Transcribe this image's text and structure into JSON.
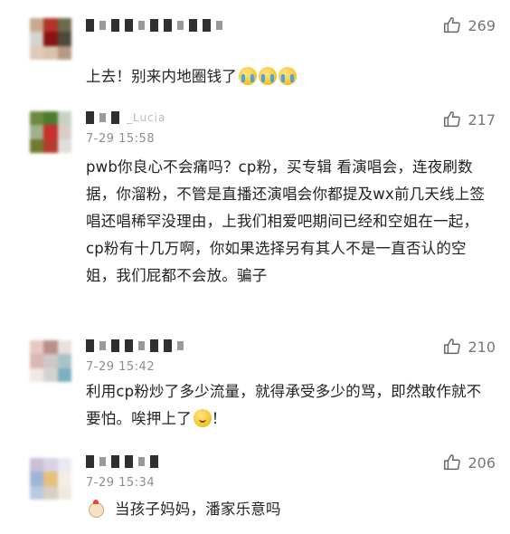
{
  "comments": [
    {
      "likes": "269",
      "time": "",
      "text": "上去！别来内地圈钱了",
      "emoji": [
        "cry",
        "cry",
        "cry"
      ],
      "avatar": [
        "#c9a98d",
        "#b3322c",
        "#6d6a4d",
        "#d5d3cf",
        "#8b1212",
        "#4d4a3a",
        "#e0c9b8",
        "#d9c3b0",
        "#b89984"
      ]
    },
    {
      "likes": "217",
      "time": "7-29 15:58",
      "username_fragment": "_Lucia",
      "text": "pwb你良心不会痛吗？cp粉，买专辑 看演唱会，连夜刷数据，你溜粉，不管是直播还演唱会你都提及wx前几天线上签唱还唱稀罕没理由，上我们相爱吧期间已经和空姐在一起，cp粉有十几万啊，你如果选择另有其人不是一直否认的空姐，我们屁都不会放。骗子",
      "avatar": [
        "#6c8a3d",
        "#4f7b2f",
        "#c7d3c2",
        "#9fb08b",
        "#c92f2f",
        "#d6cfc9",
        "#6e7a2e",
        "#b53b2e",
        "#dfdedd"
      ]
    },
    {
      "likes": "210",
      "time": "7-29 15:42",
      "text": "利用cp粉炒了多少流量，就得承受多少的骂，即然敢作就不要怕。唉押上了",
      "emoji": [
        "shy"
      ],
      "text_suffix": "！",
      "avatar": [
        "#e7c9c3",
        "#b98f89",
        "#e9e0de",
        "#d9b7b0",
        "#cfc8c6",
        "#a9c2c9",
        "#f2e8e6",
        "#d6d2cf",
        "#7bb1c0"
      ]
    },
    {
      "likes": "206",
      "time": "7-29 15:34",
      "text": "当孩子妈妈，潘家乐意吗",
      "avatar": [
        "#c9bfd8",
        "#d9d2e3",
        "#ece8f1",
        "#9db6d8",
        "#e6c17c",
        "#f3efe6",
        "#b9c9e3",
        "#d8cfc2",
        "#efe9df"
      ]
    }
  ],
  "icon": "thumbs-up-icon",
  "colors": {
    "like_text": "#777777",
    "time": "#8d8d8d",
    "body": "#222222"
  }
}
